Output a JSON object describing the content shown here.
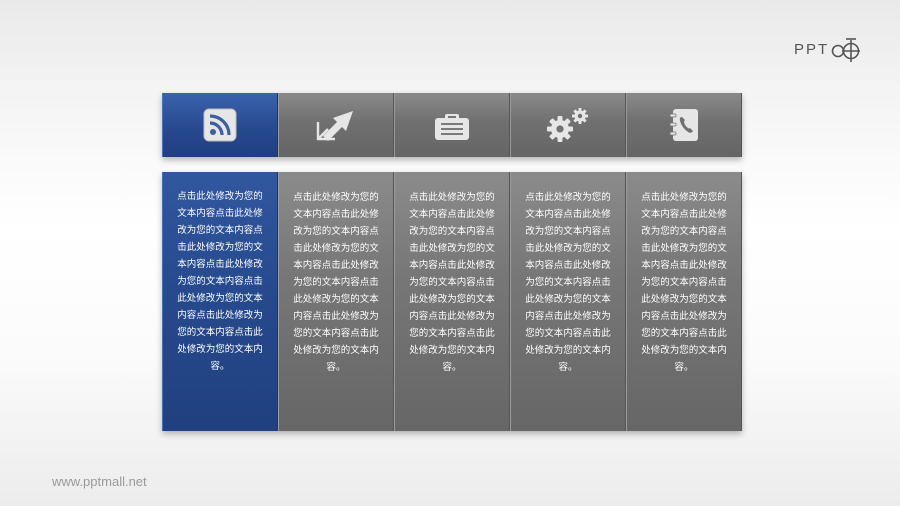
{
  "logo": {
    "text": "PPT"
  },
  "tabs": [
    {
      "icon": "rss-icon",
      "active": true
    },
    {
      "icon": "expand-arrows-icon",
      "active": false
    },
    {
      "icon": "briefcase-icon",
      "active": false
    },
    {
      "icon": "gears-icon",
      "active": false
    },
    {
      "icon": "contacts-book-icon",
      "active": false
    }
  ],
  "panels": [
    {
      "text": "点击此处修改为您的文本内容点击此处修改为您的文本内容点击此处修改为您的文本内容点击此处修改为您的文本内容点击此处修改为您的文本内容点击此处修改为您的文本内容点击此处修改为您的文本内容。"
    },
    {
      "text": "点击此处修改为您的文本内容点击此处修改为您的文本内容点击此处修改为您的文本内容点击此处修改为您的文本内容点击此处修改为您的文本内容点击此处修改为您的文本内容点击此处修改为您的文本内容。"
    },
    {
      "text": "点击此处修改为您的文本内容点击此处修改为您的文本内容点击此处修改为您的文本内容点击此处修改为您的文本内容点击此处修改为您的文本内容点击此处修改为您的文本内容点击此处修改为您的文本内容。"
    },
    {
      "text": "点击此处修改为您的文本内容点击此处修改为您的文本内容点击此处修改为您的文本内容点击此处修改为您的文本内容点击此处修改为您的文本内容点击此处修改为您的文本内容点击此处修改为您的文本内容。"
    },
    {
      "text": "点击此处修改为您的文本内容点击此处修改为您的文本内容点击此处修改为您的文本内容点击此处修改为您的文本内容点击此处修改为您的文本内容点击此处修改为您的文本内容点击此处修改为您的文本内容。"
    }
  ],
  "footer": {
    "url": "www.pptmall.net"
  },
  "colors": {
    "active": "#2a4d93",
    "inactive": "#717171",
    "icon_face": "#e4e4e4"
  }
}
